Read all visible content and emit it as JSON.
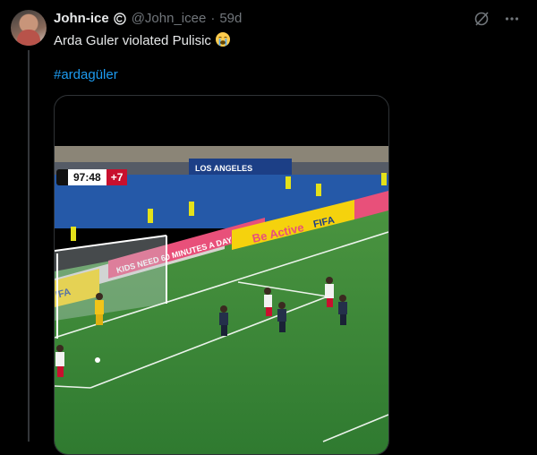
{
  "tweet": {
    "author_name": "John-ice",
    "handle": "@John_icee",
    "separator": "·",
    "time": "59d",
    "text": "Arda Guler violated Pulisic",
    "emoji": "loudly-crying-face-emoji",
    "hashtag": "#ardagüler"
  },
  "video": {
    "match_clock": "97:48",
    "added_time": "+7",
    "ad_boards": [
      "LOS ANGELES",
      "Be Active",
      "FIFA",
      "KIDS NEED 60 MINUTES A DAY",
      "IFA"
    ]
  },
  "icons": [
    "verified-icon",
    "grok-icon",
    "more-icon"
  ],
  "colors": {
    "background": "#000000",
    "link": "#1d9bf0",
    "muted": "#71767b",
    "pitch": "#3f8a3a"
  }
}
